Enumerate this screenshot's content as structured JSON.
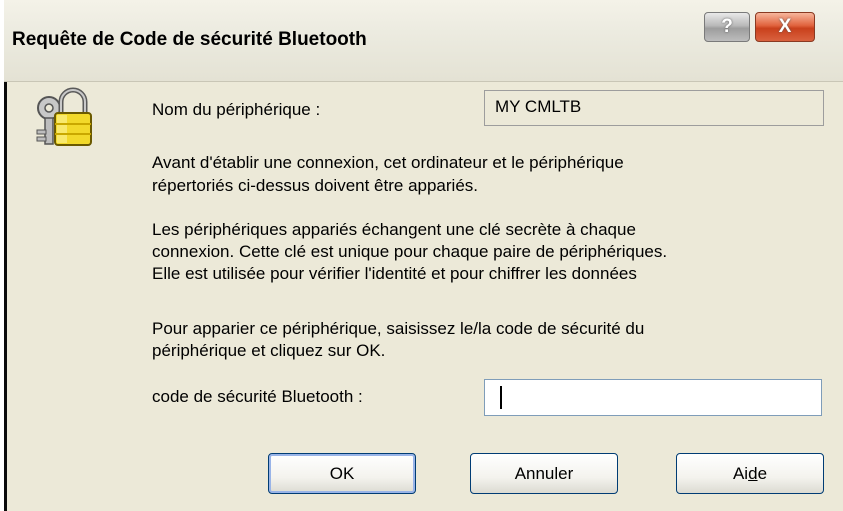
{
  "window": {
    "title": "Requête de Code de sécurité Bluetooth",
    "help_button": "?",
    "close_button": "X"
  },
  "dialog": {
    "device_name_label": "Nom du périphérique :",
    "device_name_value": "MY CMLTB",
    "paragraph1_line1": "Avant d'établir une connexion, cet ordinateur et le périphérique",
    "paragraph1_line2": "répertoriés ci-dessus doivent être appariés.",
    "paragraph2_line1": "Les périphériques appariés échangent une clé secrète à chaque",
    "paragraph2_line2": "connexion. Cette clé est unique pour chaque paire de périphériques.",
    "paragraph2_line3": "Elle est utilisée pour vérifier l'identité et pour chiffrer les données",
    "paragraph3_line1": "Pour apparier ce périphérique, saisissez le/la code de sécurité du",
    "paragraph3_line2": "périphérique et cliquez sur OK.",
    "code_label": "code de sécurité Bluetooth :",
    "code_value": ""
  },
  "buttons": {
    "ok": "OK",
    "cancel": "Annuler",
    "help_prefix": "Ai",
    "help_underlined": "d",
    "help_suffix": "e"
  },
  "icons": {
    "lock_keys": "lock-keys-icon"
  }
}
